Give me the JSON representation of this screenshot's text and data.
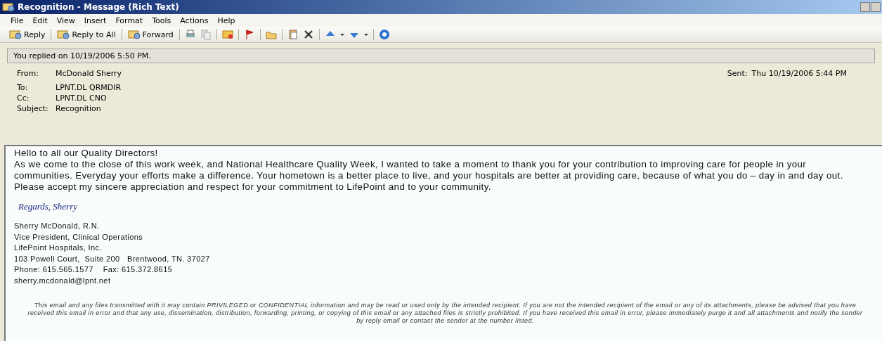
{
  "window": {
    "title": "Recognition - Message (Rich Text)"
  },
  "menu": [
    "File",
    "Edit",
    "View",
    "Insert",
    "Format",
    "Tools",
    "Actions",
    "Help"
  ],
  "toolbar": [
    {
      "label": "Reply"
    },
    {
      "label": "Reply to All"
    },
    {
      "label": "Forward"
    }
  ],
  "info_bar": "You replied on 10/19/2006 5:50 PM.",
  "header": {
    "fields": [
      {
        "label": "From:",
        "value": "McDonald Sherry"
      },
      {
        "label": "To:",
        "value": "LPNT.DL QRMDIR"
      },
      {
        "label": "Cc:",
        "value": "LPNT.DL CNO"
      },
      {
        "label": "Subject:",
        "value": "Recognition"
      }
    ],
    "sent_label": "Sent:",
    "sent_value": "Thu 10/19/2006 5:44 PM"
  },
  "body": {
    "greeting": "Hello to all our Quality Directors!",
    "paragraph": [
      "As we come to the close of this work week, and National Healthcare Quality Week, I wanted to take a moment to thank you for your contribution to improving care for people in your",
      "communities. Everyday your efforts make a difference.  Your hometown is a better place to live, and your hospitals are better at providing care, because of what you do – day in and day out.",
      "Please accept my sincere appreciation and respect for your commitment to LifePoint and to your community."
    ],
    "closing": "Regards, Sherry",
    "signature": [
      "Sherry McDonald, R.N.",
      "Vice President, Clinical Operations",
      "LifePoint Hospitals, Inc.",
      "103 Powell Court,  Suite 200   Brentwood, TN. 37027",
      "Phone: 615.565.1577    Fax: 615.372.8615"
    ],
    "email": "sherry.mcdonald@lpnt.net",
    "disclaimer": [
      "This email and any files transmitted with it may contain PRIVILEGED or CONFIDENTIAL information and may be read or used only by the intended recipient. If you are not the intended recipient of the email or any of its attachments, please be advised that you have",
      "received this email in error and that any use, dissemination, distribution, forwarding, printing, or copying of this email or any attached files is strictly prohibited. If you have received this email in error, please immediately purge it and all attachments and notify the sender",
      "by reply email or contact the sender at the number listed."
    ]
  }
}
